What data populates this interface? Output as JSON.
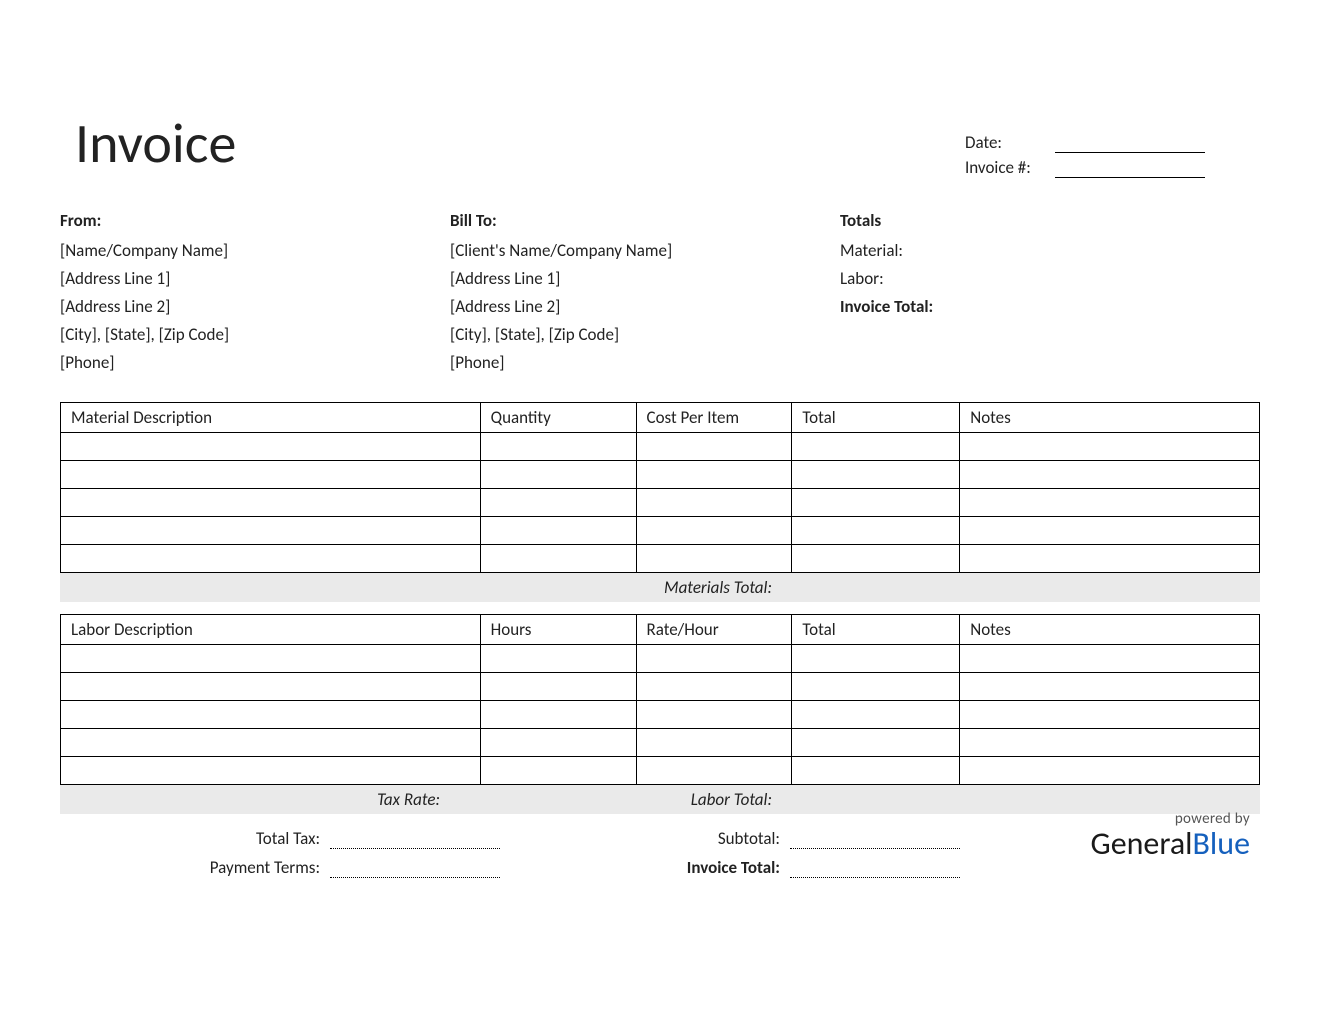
{
  "title": "Invoice",
  "meta": {
    "date_label": "Date:",
    "invoice_num_label": "Invoice #:"
  },
  "from": {
    "heading": "From:",
    "name": "[Name/Company Name]",
    "addr1": "[Address Line 1]",
    "addr2": "[Address Line 2]",
    "city": "[City], [State], [Zip Code]",
    "phone": "[Phone]"
  },
  "billto": {
    "heading": "Bill To:",
    "name": "[Client's Name/Company Name]",
    "addr1": "[Address Line 1]",
    "addr2": "[Address Line 2]",
    "city": "[City], [State], [Zip Code]",
    "phone": "[Phone]"
  },
  "totals": {
    "heading": "Totals",
    "material": "Material:",
    "labor": "Labor:",
    "invoice_total": "Invoice Total:"
  },
  "materials_table": {
    "headers": {
      "desc": "Material Description",
      "qty": "Quantity",
      "cost": "Cost Per Item",
      "total": "Total",
      "notes": "Notes"
    }
  },
  "materials_total_label": "Materials Total:",
  "labor_table": {
    "headers": {
      "desc": "Labor Description",
      "hours": "Hours",
      "rate": "Rate/Hour",
      "total": "Total",
      "notes": "Notes"
    }
  },
  "tax_rate_label": "Tax Rate:",
  "labor_total_label": "Labor Total:",
  "summary": {
    "total_tax": "Total Tax:",
    "subtotal": "Subtotal:",
    "payment_terms": "Payment Terms:",
    "invoice_total": "Invoice Total:"
  },
  "footer": {
    "powered": "powered by",
    "logo_1": "General",
    "logo_2": "Blue"
  }
}
